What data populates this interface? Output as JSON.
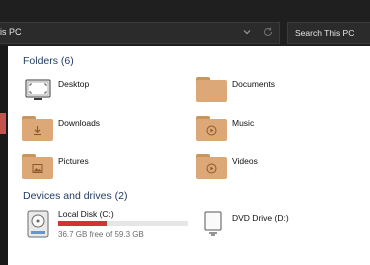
{
  "address_bar": {
    "path_text": "is PC"
  },
  "search": {
    "placeholder": "Search This PC"
  },
  "folders_section": {
    "title": "Folders (6)",
    "items": [
      {
        "label": "Desktop",
        "icon": "desktop-icon"
      },
      {
        "label": "Documents",
        "icon": "documents-folder-icon"
      },
      {
        "label": "Downloads",
        "icon": "downloads-folder-icon"
      },
      {
        "label": "Music",
        "icon": "music-folder-icon"
      },
      {
        "label": "Pictures",
        "icon": "pictures-folder-icon"
      },
      {
        "label": "Videos",
        "icon": "videos-folder-icon"
      }
    ]
  },
  "devices_section": {
    "title": "Devices and drives (2)",
    "drives": [
      {
        "name": "Local Disk (C:)",
        "free_text": "36.7 GB free of 59.3 GB",
        "used_fraction": 0.38,
        "icon": "hard-disk-icon"
      },
      {
        "name": "DVD Drive (D:)",
        "icon": "dvd-drive-icon"
      }
    ]
  },
  "colors": {
    "folder": "#dca877",
    "folder_dark": "#c9955e",
    "usage_bar": "#d13438",
    "section_title": "#1e3a5f",
    "nav_accent": "#c25450"
  }
}
